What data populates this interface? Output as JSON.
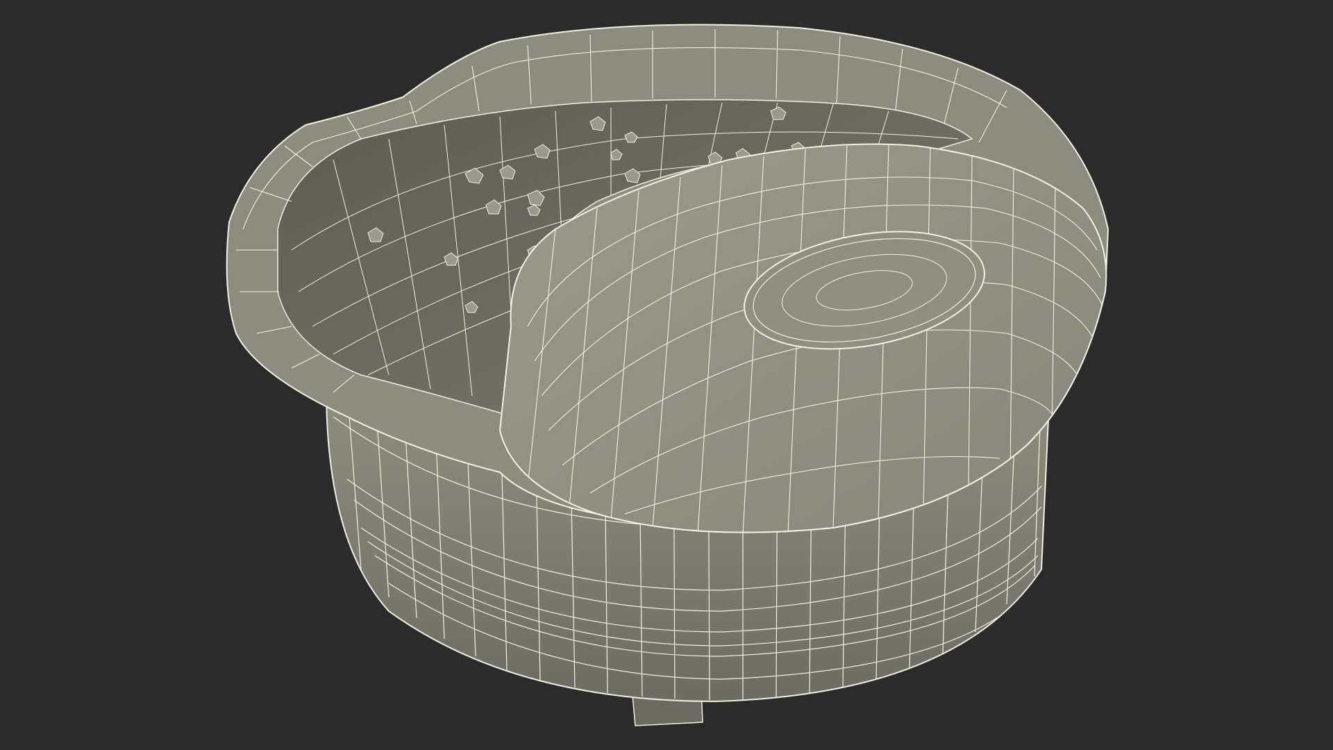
{
  "scene": {
    "background_color": "#2b2b2b",
    "subject": "wireframe-tub-model",
    "mesh_fill_color": "#8a8a7c",
    "mesh_fill_dark": "#5f5f55",
    "mesh_fill_light": "#a3a396",
    "wire_color": "#f1f1e4"
  }
}
